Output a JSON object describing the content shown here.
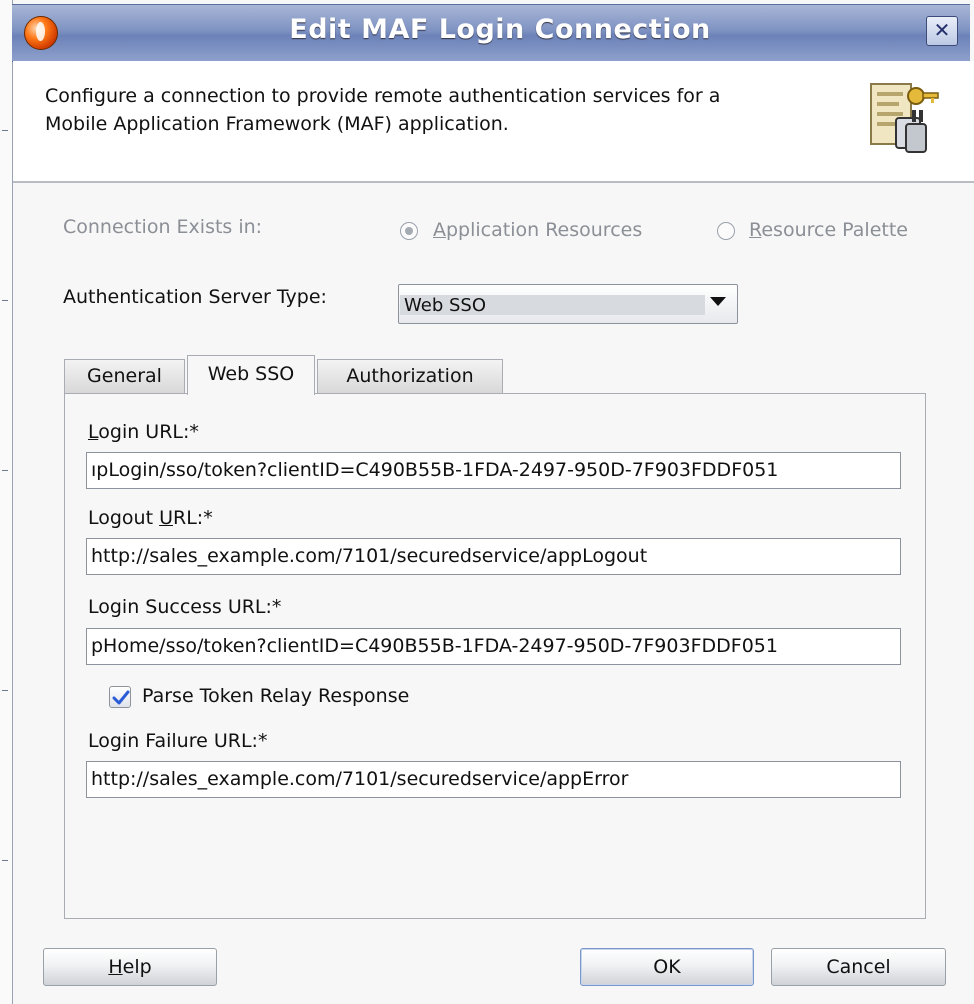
{
  "window": {
    "title": "Edit MAF Login Connection",
    "close_symbol": "✕"
  },
  "header": {
    "description_line1": "Configure a connection to provide remote authentication services for a",
    "description_line2": "Mobile Application Framework (MAF) application.",
    "icon": "connection-key-icon"
  },
  "connection_exists": {
    "label": "Connection Exists in:",
    "options": [
      {
        "mnemonic": "A",
        "rest": "pplication Resources",
        "selected": true,
        "enabled": false
      },
      {
        "mnemonic": "R",
        "rest": "esource Palette",
        "selected": false,
        "enabled": false
      }
    ]
  },
  "auth_server_type": {
    "label": "Authentication Server Type:",
    "value": "Web SSO"
  },
  "tabs": [
    {
      "label": "General",
      "active": false
    },
    {
      "label": "Web SSO",
      "active": true
    },
    {
      "label": "Authorization",
      "active": false
    }
  ],
  "fields": {
    "login_url": {
      "label_mnemonic": "L",
      "label_rest": "ogin URL:*",
      "value": "ıpLogin/sso/token?clientID=C490B55B-1FDA-2497-950D-7F903FDDF051"
    },
    "logout_url": {
      "label_pre": "Logout ",
      "label_mnemonic": "U",
      "label_rest": "RL:*",
      "value": "http://sales_example.com/7101/securedservice/appLogout"
    },
    "login_success_url": {
      "label": "Login Success URL:*",
      "value": "pHome/sso/token?clientID=C490B55B-1FDA-2497-950D-7F903FDDF051"
    },
    "parse_token": {
      "label": "Parse Token Relay Response",
      "checked": true
    },
    "login_failure_url": {
      "label": "Login Failure URL:*",
      "value": "http://sales_example.com/7101/securedservice/appError"
    }
  },
  "buttons": {
    "help_mnemonic": "H",
    "help_rest": "elp",
    "ok": "OK",
    "cancel": "Cancel"
  },
  "colors": {
    "titlebar": "#7f93c3",
    "checkmark": "#2a5bd7"
  }
}
